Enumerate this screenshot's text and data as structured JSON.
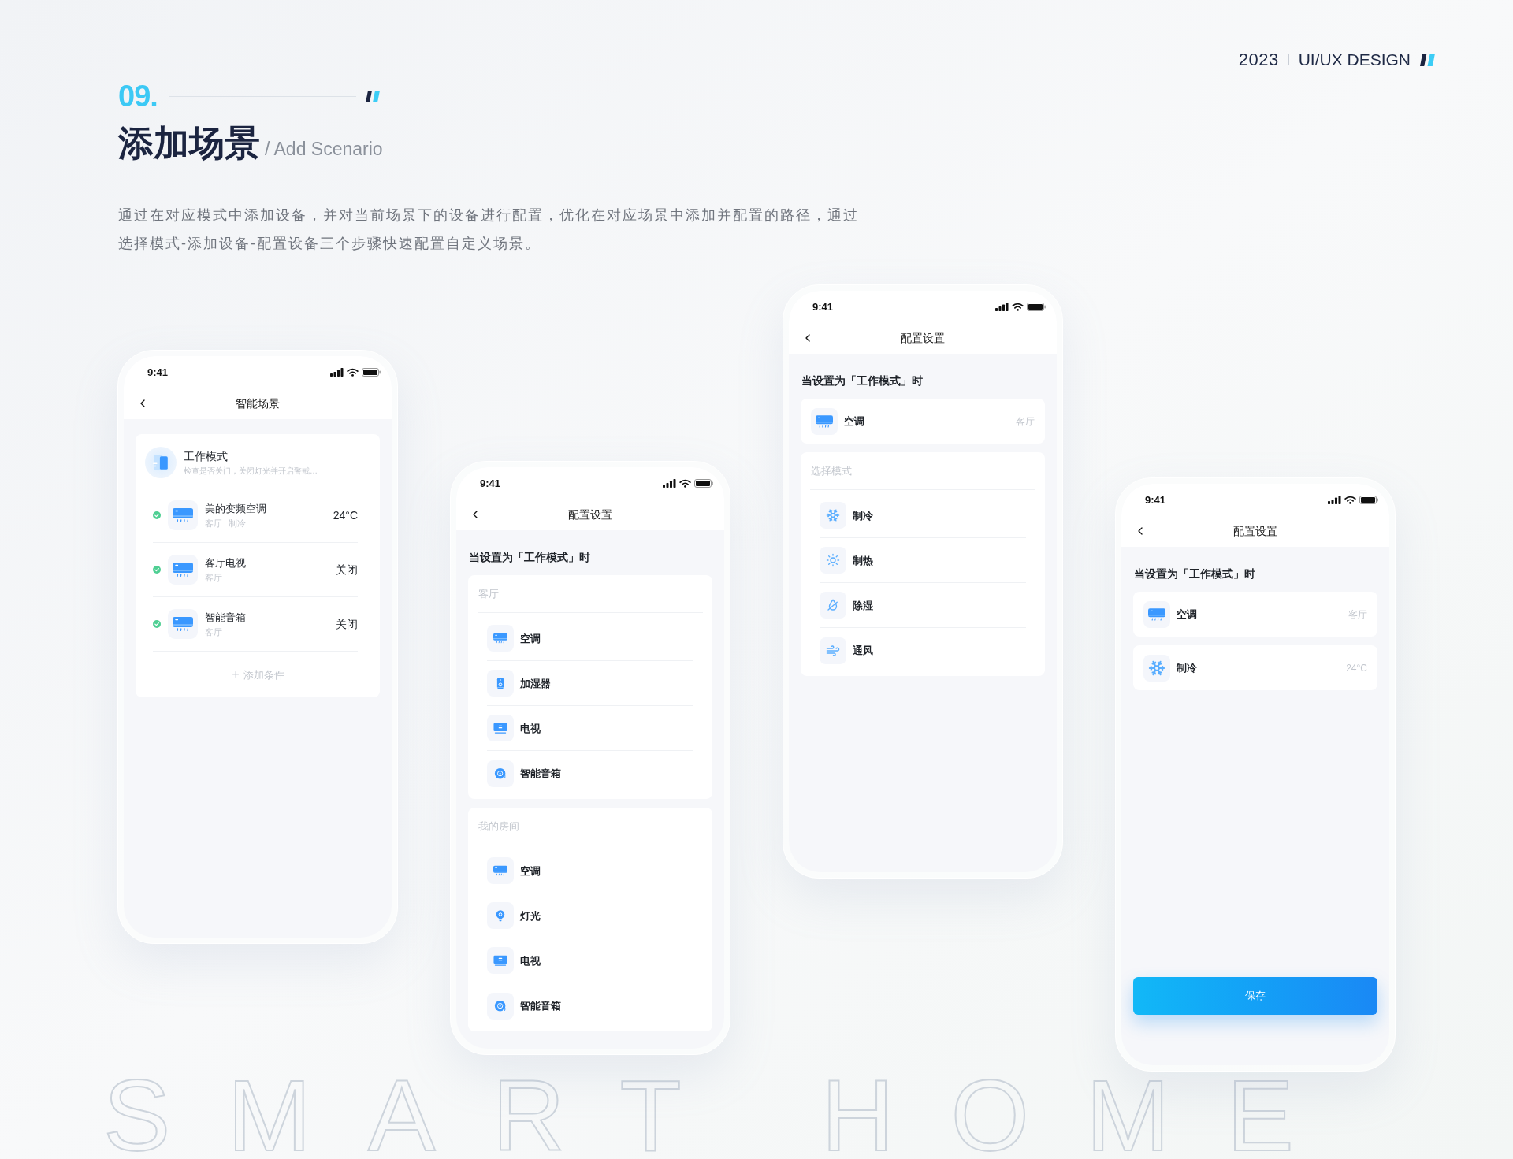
{
  "header": {
    "number": "09.",
    "title": "添加场景",
    "subtitle": "/ Add Scenario",
    "description": "通过在对应模式中添加设备，并对当前场景下的设备进行配置，优化在对应场景中添加并配置的路径，通过选择模式-添加设备-配置设备三个步骤快速配置自定义场景。"
  },
  "brand": {
    "year": "2023",
    "label": "UI/UX DESIGN"
  },
  "screens": [
    {
      "status_bar": {
        "time": "9:41"
      },
      "nav_title": "智能场景",
      "scene_card": {
        "name": "工作模式",
        "description": "检查是否关门，关闭灯光并开启警戒…",
        "conditions": [
          {
            "name": "美的变频空调",
            "tags": [
              "客厅",
              "制冷"
            ],
            "value": "24°C",
            "checked": true,
            "kind": "ac"
          },
          {
            "name": "客厅电视",
            "tags": [
              "客厅"
            ],
            "value": "关闭",
            "checked": true,
            "kind": "ac"
          },
          {
            "name": "智能音箱",
            "tags": [
              "客厅"
            ],
            "value": "关闭",
            "checked": true,
            "kind": "ac"
          }
        ],
        "add_label": "添加条件"
      }
    },
    {
      "status_bar": {
        "time": "9:41"
      },
      "nav_title": "配置设置",
      "prompt": "当设置为「工作模式」时",
      "groups": [
        {
          "label": "客厅",
          "items": [
            {
              "name": "空调",
              "kind": "ac"
            },
            {
              "name": "加湿器",
              "kind": "humidifier"
            },
            {
              "name": "电视",
              "kind": "tv"
            },
            {
              "name": "智能音箱",
              "kind": "speaker"
            }
          ]
        },
        {
          "label": "我的房间",
          "items": [
            {
              "name": "空调",
              "kind": "ac"
            },
            {
              "name": "灯光",
              "kind": "light"
            },
            {
              "name": "电视",
              "kind": "tv"
            },
            {
              "name": "智能音箱",
              "kind": "speaker"
            }
          ]
        }
      ]
    },
    {
      "status_bar": {
        "time": "9:41"
      },
      "nav_title": "配置设置",
      "prompt": "当设置为「工作模式」时",
      "cards": [
        {
          "name": "空调",
          "detail": "客厅",
          "kind": "ac"
        }
      ],
      "groups": [
        {
          "label": "选择模式",
          "items": [
            {
              "name": "制冷",
              "kind": "cool"
            },
            {
              "name": "制热",
              "kind": "heat"
            },
            {
              "name": "除湿",
              "kind": "dry"
            },
            {
              "name": "通风",
              "kind": "fan"
            }
          ]
        }
      ]
    },
    {
      "status_bar": {
        "time": "9:41"
      },
      "nav_title": "配置设置",
      "prompt": "当设置为「工作模式」时",
      "cards": [
        {
          "name": "空调",
          "detail": "客厅",
          "kind": "ac"
        },
        {
          "name": "制冷",
          "detail": "24°C",
          "kind": "cool"
        }
      ],
      "button": "保存"
    }
  ],
  "background_text": "SMART HOME"
}
